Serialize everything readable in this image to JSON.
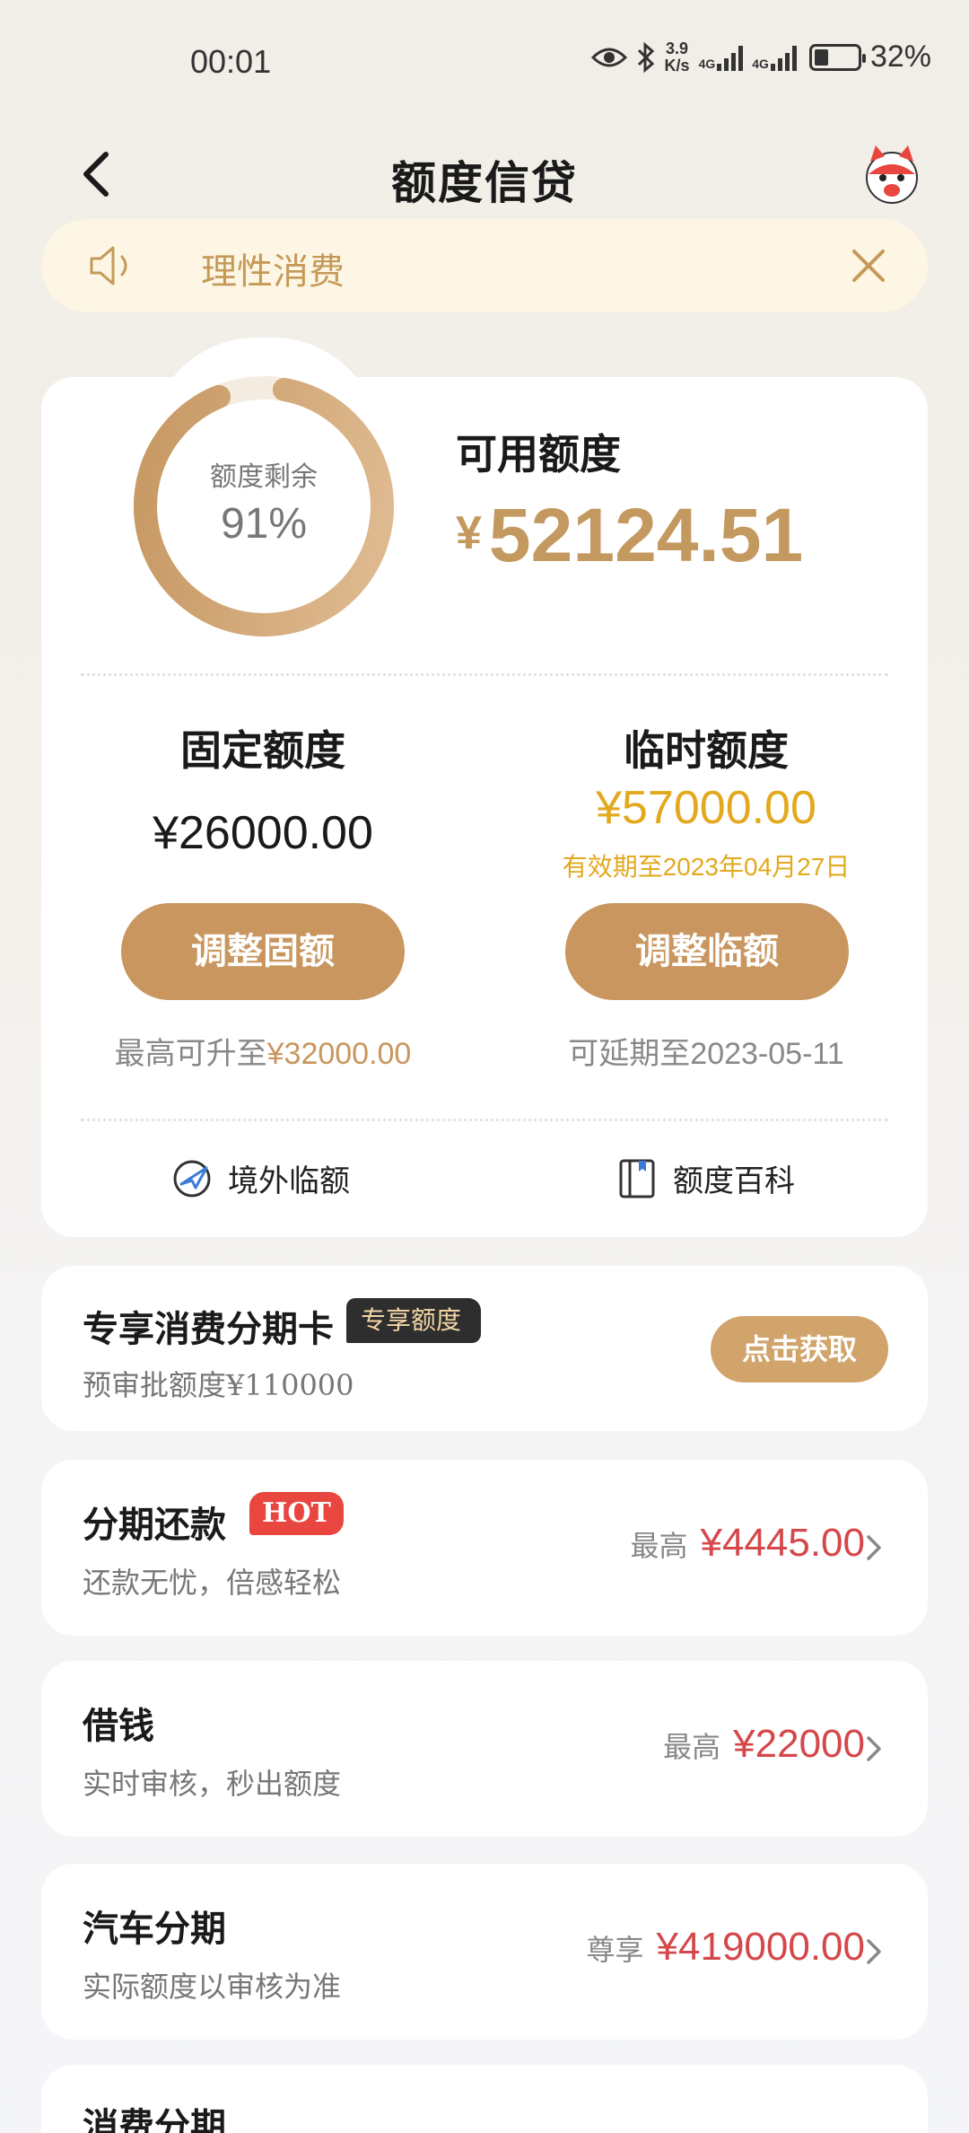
{
  "status": {
    "time": "00:01",
    "net_speed_value": "3.9",
    "net_speed_unit": "K/s",
    "sig1": "4G",
    "sig2": "4G",
    "battery": "32%",
    "battery_level": 0.32
  },
  "header": {
    "title": "额度信贷"
  },
  "notice": {
    "text": "理性消费"
  },
  "credit": {
    "ring_label": "额度剩余",
    "ring_percent": "91%",
    "ring_fraction": 0.91,
    "available_label": "可用额度",
    "currency": "¥",
    "available_amount": "52124.51"
  },
  "fixed": {
    "title": "固定额度",
    "amount": "¥26000.00",
    "button": "调整固额",
    "note_prefix": "最高可升至",
    "note_value": "¥32000.00"
  },
  "temp": {
    "title": "临时额度",
    "amount": "¥57000.00",
    "valid": "有效期至2023年04月27日",
    "button": "调整临额",
    "note": "可延期至2023-05-11"
  },
  "tools": {
    "overseas": "境外临额",
    "wiki": "额度百科"
  },
  "exclusive": {
    "title": "专享消费分期卡",
    "tag": "专享额度",
    "subtitle": "预审批额度¥110000",
    "button": "点击获取"
  },
  "products": [
    {
      "title": "分期还款",
      "badge": "HOT",
      "subtitle": "还款无忧，倍感轻松",
      "prefix": "最高",
      "amount": "¥4445.00"
    },
    {
      "title": "借钱",
      "subtitle": "实时审核，秒出额度",
      "prefix": "最高",
      "amount": "¥22000"
    },
    {
      "title": "汽车分期",
      "subtitle": "实际额度以审核为准",
      "prefix": "尊享",
      "amount": "¥419000.00"
    },
    {
      "title": "消费分期"
    }
  ],
  "colors": {
    "gold": "#c8965e",
    "red": "#d5474a",
    "yellow": "#e2a91e"
  }
}
